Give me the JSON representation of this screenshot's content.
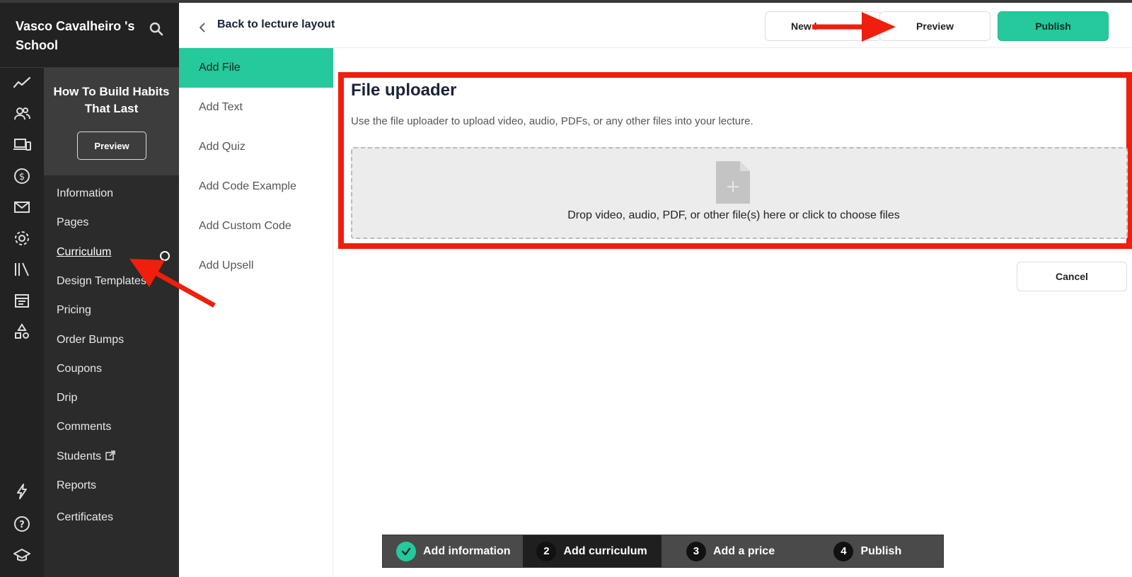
{
  "school": {
    "name": "Vasco Cavalheiro 's School"
  },
  "rail": [
    "analytics-icon",
    "users-icon",
    "devices-icon",
    "dollar-icon",
    "mail-icon",
    "gear-icon",
    "library-icon",
    "calendar-icon",
    "shapes-icon",
    "lightning-icon",
    "help-icon",
    "graduation-icon"
  ],
  "course": {
    "title": "How To Build Habits That Last",
    "preview_label": "Preview",
    "menu": [
      "Information",
      "Pages",
      "Curriculum",
      "Design Templates",
      "Pricing",
      "Order Bumps",
      "Coupons",
      "Drip",
      "Comments",
      "Students",
      "Reports",
      "Certificates"
    ],
    "active": "Curriculum"
  },
  "topbar": {
    "back_label": "Back to lecture layout",
    "new_label": "New l",
    "preview_label": "Preview",
    "publish_label": "Publish"
  },
  "subnav": [
    "Add File",
    "Add Text",
    "Add Quiz",
    "Add Code Example",
    "Add Custom Code",
    "Add Upsell"
  ],
  "uploader": {
    "title": "File uploader",
    "description": "Use the file uploader to upload video, audio, PDFs, or any other files into your lecture.",
    "drop_text": "Drop video, audio, PDF, or other file(s) here or click to choose files",
    "cancel_label": "Cancel"
  },
  "stepper": [
    {
      "number": "",
      "label": "Add information",
      "status": "done"
    },
    {
      "number": "2",
      "label": "Add curriculum",
      "status": "current"
    },
    {
      "number": "3",
      "label": "Add a price",
      "status": "upcoming"
    },
    {
      "number": "4",
      "label": "Publish",
      "status": "upcoming"
    }
  ],
  "colors": {
    "accent": "#25c99b",
    "annotation": "#f01e0c",
    "sidebar": "#222222"
  }
}
